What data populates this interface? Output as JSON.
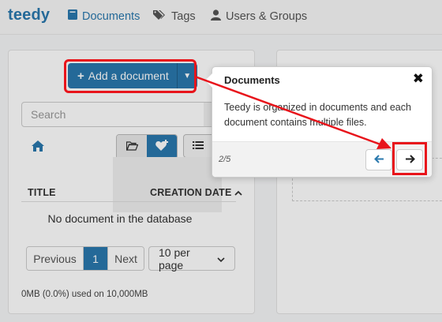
{
  "navbar": {
    "brand": "teedy",
    "items": [
      {
        "label": "Documents",
        "icon": "book-icon",
        "active": true
      },
      {
        "label": "Tags",
        "icon": "tags-icon",
        "active": false
      },
      {
        "label": "Users & Groups",
        "icon": "user-icon",
        "active": false
      }
    ]
  },
  "toolbar": {
    "add_label": "Add a document",
    "search_placeholder": "Search"
  },
  "table": {
    "col_title": "TITLE",
    "col_date": "CREATION DATE",
    "empty": "No document in the database"
  },
  "pager": {
    "prev": "Previous",
    "page": "1",
    "next": "Next",
    "per_page": "10 per page"
  },
  "quota": "0MB (0.0%) used on 10,000MB",
  "popover": {
    "title": "Documents",
    "body": "Teedy is organized in documents and each document contains multiple files.",
    "step": "2/5"
  },
  "colors": {
    "accent": "#2a78ad",
    "highlight": "#e8141b"
  }
}
